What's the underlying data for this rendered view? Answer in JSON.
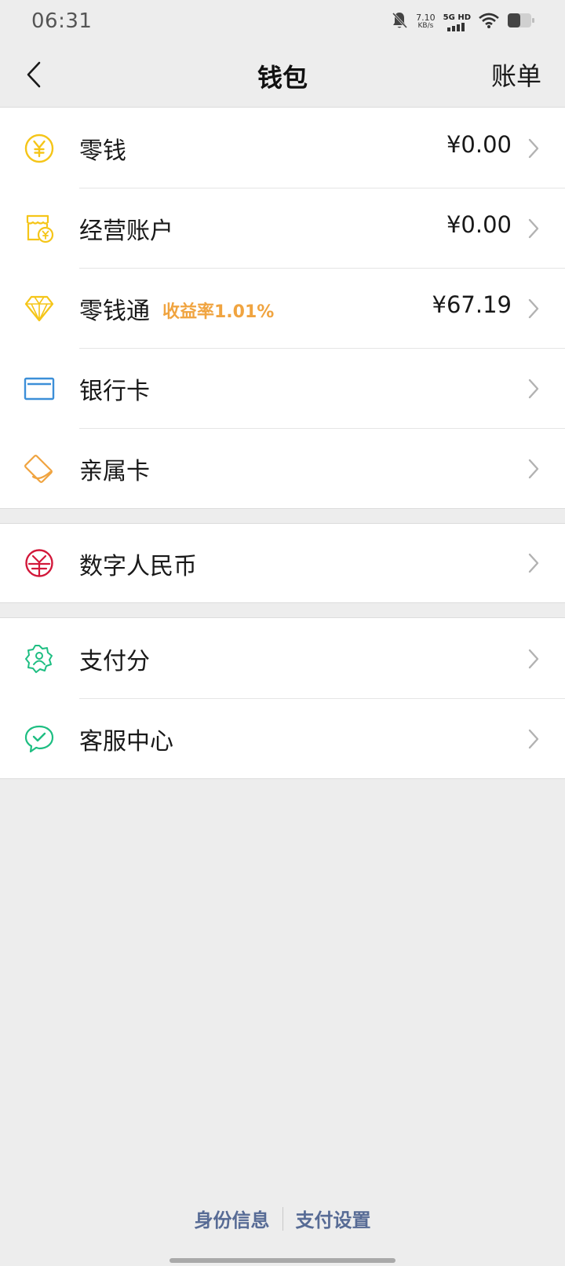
{
  "status_bar": {
    "time": "06:31",
    "net_speed_value": "7.10",
    "net_speed_unit": "KB/s",
    "network_label": "5G HD",
    "icons": [
      "bell-muted-icon",
      "signal-icon",
      "wifi-icon",
      "battery-icon"
    ]
  },
  "header": {
    "title": "钱包",
    "bill_label": "账单",
    "back_icon": "chevron-left-icon"
  },
  "wallet_items": [
    {
      "label": "零钱",
      "value": "¥0.00",
      "icon": "yuan-coin-icon",
      "color": "#F5C518"
    },
    {
      "label": "经营账户",
      "value": "¥0.00",
      "icon": "shop-account-icon",
      "color": "#F5C518"
    },
    {
      "label": "零钱通",
      "badge": "收益率1.01%",
      "value": "¥67.19",
      "icon": "diamond-icon",
      "color": "#F5C518"
    },
    {
      "label": "银行卡",
      "icon": "bank-card-icon",
      "color": "#3C8FD8"
    },
    {
      "label": "亲属卡",
      "icon": "family-card-icon",
      "color": "#F0A440"
    }
  ],
  "digital_items": [
    {
      "label": "数字人民币",
      "icon": "digital-rmb-icon",
      "color": "#D2183A"
    }
  ],
  "service_items": [
    {
      "label": "支付分",
      "icon": "pay-score-icon",
      "color": "#1EBE82"
    },
    {
      "label": "客服中心",
      "icon": "customer-service-icon",
      "color": "#1EBE82"
    }
  ],
  "footer": {
    "identity_label": "身份信息",
    "settings_label": "支付设置"
  },
  "colors": {
    "background": "#EDEDED",
    "link": "#576B95",
    "badge": "#F0A440"
  }
}
